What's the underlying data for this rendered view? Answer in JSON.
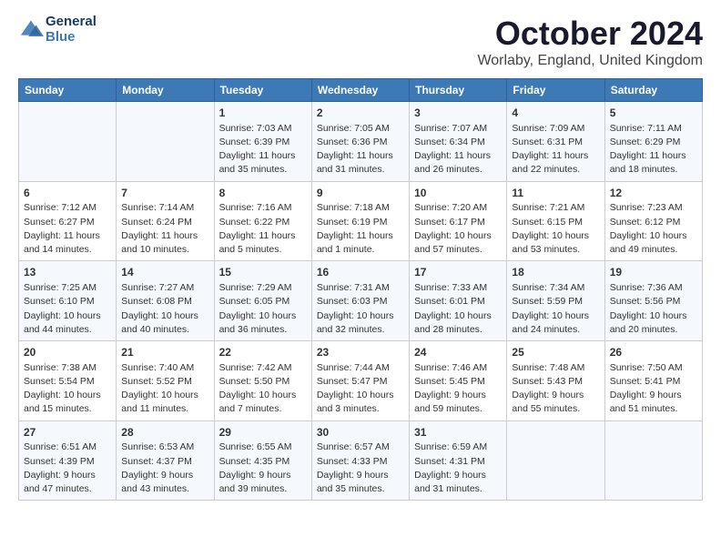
{
  "header": {
    "logo_line1": "General",
    "logo_line2": "Blue",
    "month_title": "October 2024",
    "subtitle": "Worlaby, England, United Kingdom"
  },
  "weekdays": [
    "Sunday",
    "Monday",
    "Tuesday",
    "Wednesday",
    "Thursday",
    "Friday",
    "Saturday"
  ],
  "weeks": [
    [
      {
        "day": "",
        "info": ""
      },
      {
        "day": "",
        "info": ""
      },
      {
        "day": "1",
        "info": "Sunrise: 7:03 AM\nSunset: 6:39 PM\nDaylight: 11 hours and 35 minutes."
      },
      {
        "day": "2",
        "info": "Sunrise: 7:05 AM\nSunset: 6:36 PM\nDaylight: 11 hours and 31 minutes."
      },
      {
        "day": "3",
        "info": "Sunrise: 7:07 AM\nSunset: 6:34 PM\nDaylight: 11 hours and 26 minutes."
      },
      {
        "day": "4",
        "info": "Sunrise: 7:09 AM\nSunset: 6:31 PM\nDaylight: 11 hours and 22 minutes."
      },
      {
        "day": "5",
        "info": "Sunrise: 7:11 AM\nSunset: 6:29 PM\nDaylight: 11 hours and 18 minutes."
      }
    ],
    [
      {
        "day": "6",
        "info": "Sunrise: 7:12 AM\nSunset: 6:27 PM\nDaylight: 11 hours and 14 minutes."
      },
      {
        "day": "7",
        "info": "Sunrise: 7:14 AM\nSunset: 6:24 PM\nDaylight: 11 hours and 10 minutes."
      },
      {
        "day": "8",
        "info": "Sunrise: 7:16 AM\nSunset: 6:22 PM\nDaylight: 11 hours and 5 minutes."
      },
      {
        "day": "9",
        "info": "Sunrise: 7:18 AM\nSunset: 6:19 PM\nDaylight: 11 hours and 1 minute."
      },
      {
        "day": "10",
        "info": "Sunrise: 7:20 AM\nSunset: 6:17 PM\nDaylight: 10 hours and 57 minutes."
      },
      {
        "day": "11",
        "info": "Sunrise: 7:21 AM\nSunset: 6:15 PM\nDaylight: 10 hours and 53 minutes."
      },
      {
        "day": "12",
        "info": "Sunrise: 7:23 AM\nSunset: 6:12 PM\nDaylight: 10 hours and 49 minutes."
      }
    ],
    [
      {
        "day": "13",
        "info": "Sunrise: 7:25 AM\nSunset: 6:10 PM\nDaylight: 10 hours and 44 minutes."
      },
      {
        "day": "14",
        "info": "Sunrise: 7:27 AM\nSunset: 6:08 PM\nDaylight: 10 hours and 40 minutes."
      },
      {
        "day": "15",
        "info": "Sunrise: 7:29 AM\nSunset: 6:05 PM\nDaylight: 10 hours and 36 minutes."
      },
      {
        "day": "16",
        "info": "Sunrise: 7:31 AM\nSunset: 6:03 PM\nDaylight: 10 hours and 32 minutes."
      },
      {
        "day": "17",
        "info": "Sunrise: 7:33 AM\nSunset: 6:01 PM\nDaylight: 10 hours and 28 minutes."
      },
      {
        "day": "18",
        "info": "Sunrise: 7:34 AM\nSunset: 5:59 PM\nDaylight: 10 hours and 24 minutes."
      },
      {
        "day": "19",
        "info": "Sunrise: 7:36 AM\nSunset: 5:56 PM\nDaylight: 10 hours and 20 minutes."
      }
    ],
    [
      {
        "day": "20",
        "info": "Sunrise: 7:38 AM\nSunset: 5:54 PM\nDaylight: 10 hours and 15 minutes."
      },
      {
        "day": "21",
        "info": "Sunrise: 7:40 AM\nSunset: 5:52 PM\nDaylight: 10 hours and 11 minutes."
      },
      {
        "day": "22",
        "info": "Sunrise: 7:42 AM\nSunset: 5:50 PM\nDaylight: 10 hours and 7 minutes."
      },
      {
        "day": "23",
        "info": "Sunrise: 7:44 AM\nSunset: 5:47 PM\nDaylight: 10 hours and 3 minutes."
      },
      {
        "day": "24",
        "info": "Sunrise: 7:46 AM\nSunset: 5:45 PM\nDaylight: 9 hours and 59 minutes."
      },
      {
        "day": "25",
        "info": "Sunrise: 7:48 AM\nSunset: 5:43 PM\nDaylight: 9 hours and 55 minutes."
      },
      {
        "day": "26",
        "info": "Sunrise: 7:50 AM\nSunset: 5:41 PM\nDaylight: 9 hours and 51 minutes."
      }
    ],
    [
      {
        "day": "27",
        "info": "Sunrise: 6:51 AM\nSunset: 4:39 PM\nDaylight: 9 hours and 47 minutes."
      },
      {
        "day": "28",
        "info": "Sunrise: 6:53 AM\nSunset: 4:37 PM\nDaylight: 9 hours and 43 minutes."
      },
      {
        "day": "29",
        "info": "Sunrise: 6:55 AM\nSunset: 4:35 PM\nDaylight: 9 hours and 39 minutes."
      },
      {
        "day": "30",
        "info": "Sunrise: 6:57 AM\nSunset: 4:33 PM\nDaylight: 9 hours and 35 minutes."
      },
      {
        "day": "31",
        "info": "Sunrise: 6:59 AM\nSunset: 4:31 PM\nDaylight: 9 hours and 31 minutes."
      },
      {
        "day": "",
        "info": ""
      },
      {
        "day": "",
        "info": ""
      }
    ]
  ]
}
